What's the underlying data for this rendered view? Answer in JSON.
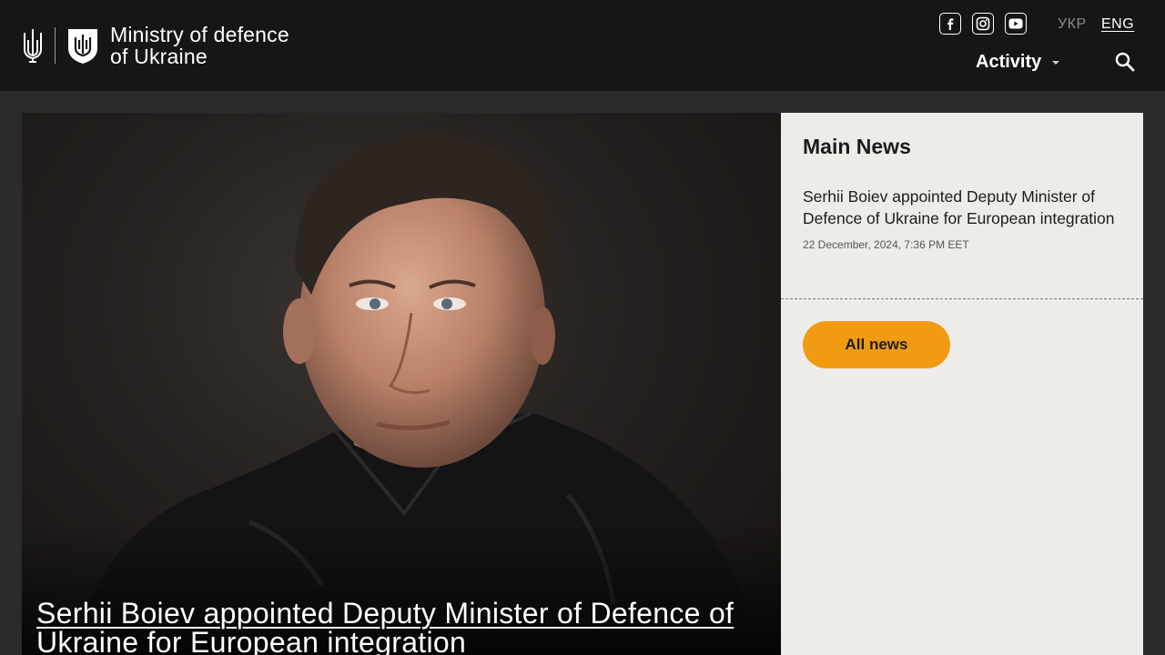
{
  "header": {
    "brand_line1": "Ministry of defence",
    "brand_line2": "of Ukraine",
    "social": [
      {
        "name": "facebook",
        "icon": "facebook-icon"
      },
      {
        "name": "instagram",
        "icon": "instagram-icon"
      },
      {
        "name": "youtube",
        "icon": "youtube-icon"
      }
    ],
    "languages": [
      "УКР",
      "ENG"
    ],
    "active_language": "ENG",
    "nav": {
      "activity_label": "Activity",
      "activity_icon": "caret-down-icon",
      "search_icon": "search-icon"
    }
  },
  "hero": {
    "title": "Serhii Boiev appointed Deputy Minister of Defence of Ukraine for European integration"
  },
  "sidebar": {
    "heading": "Main News",
    "news": [
      {
        "title": "Serhii Boiev appointed Deputy Minister of Defence of Ukraine for European integration",
        "date": "22 December, 2024, 7:36 PM EET"
      }
    ],
    "all_news_label": "All news"
  },
  "colors": {
    "header_bg": "#161616",
    "page_bg": "#2b2b2b",
    "sidebar_bg": "#edece8",
    "accent": "#f19b12"
  }
}
